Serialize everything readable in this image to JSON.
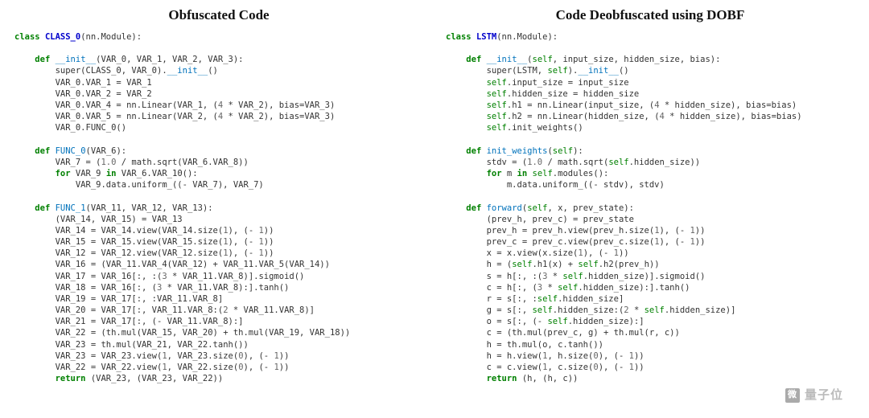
{
  "left": {
    "title": "Obfuscated Code",
    "code": [
      {
        "t": "line",
        "spans": [
          {
            "c": "kw",
            "s": "class "
          },
          {
            "c": "cls",
            "s": "CLASS_0"
          },
          {
            "c": "",
            "s": "(nn.Module):"
          }
        ]
      },
      {
        "t": "blank"
      },
      {
        "t": "line",
        "indent": 1,
        "spans": [
          {
            "c": "kw",
            "s": "def "
          },
          {
            "c": "fn",
            "s": "__init__"
          },
          {
            "c": "",
            "s": "(VAR_0, VAR_1, VAR_2, VAR_3):"
          }
        ]
      },
      {
        "t": "line",
        "indent": 2,
        "spans": [
          {
            "c": "",
            "s": "super(CLASS_0, VAR_0)."
          },
          {
            "c": "fn",
            "s": "__init__"
          },
          {
            "c": "",
            "s": "()"
          }
        ]
      },
      {
        "t": "line",
        "indent": 2,
        "spans": [
          {
            "c": "",
            "s": "VAR_0.VAR_1 = VAR_1"
          }
        ]
      },
      {
        "t": "line",
        "indent": 2,
        "spans": [
          {
            "c": "",
            "s": "VAR_0.VAR_2 = VAR_2"
          }
        ]
      },
      {
        "t": "line",
        "indent": 2,
        "spans": [
          {
            "c": "",
            "s": "VAR_0.VAR_4 = nn.Linear(VAR_1, ("
          },
          {
            "c": "num",
            "s": "4"
          },
          {
            "c": "",
            "s": " * VAR_2), bias=VAR_3)"
          }
        ]
      },
      {
        "t": "line",
        "indent": 2,
        "spans": [
          {
            "c": "",
            "s": "VAR_0.VAR_5 = nn.Linear(VAR_2, ("
          },
          {
            "c": "num",
            "s": "4"
          },
          {
            "c": "",
            "s": " * VAR_2), bias=VAR_3)"
          }
        ]
      },
      {
        "t": "line",
        "indent": 2,
        "spans": [
          {
            "c": "",
            "s": "VAR_0.FUNC_0()"
          }
        ]
      },
      {
        "t": "blank"
      },
      {
        "t": "line",
        "indent": 1,
        "spans": [
          {
            "c": "kw",
            "s": "def "
          },
          {
            "c": "fn",
            "s": "FUNC_0"
          },
          {
            "c": "",
            "s": "(VAR_6):"
          }
        ]
      },
      {
        "t": "line",
        "indent": 2,
        "spans": [
          {
            "c": "",
            "s": "VAR_7 = ("
          },
          {
            "c": "num",
            "s": "1.0"
          },
          {
            "c": "",
            "s": " / math.sqrt(VAR_6.VAR_8))"
          }
        ]
      },
      {
        "t": "line",
        "indent": 2,
        "spans": [
          {
            "c": "kw",
            "s": "for"
          },
          {
            "c": "",
            "s": " VAR_9 "
          },
          {
            "c": "kw",
            "s": "in"
          },
          {
            "c": "",
            "s": " VAR_6.VAR_10():"
          }
        ]
      },
      {
        "t": "line",
        "indent": 3,
        "spans": [
          {
            "c": "",
            "s": "VAR_9.data.uniform_((- VAR_7), VAR_7)"
          }
        ]
      },
      {
        "t": "blank"
      },
      {
        "t": "line",
        "indent": 1,
        "spans": [
          {
            "c": "kw",
            "s": "def "
          },
          {
            "c": "fn",
            "s": "FUNC_1"
          },
          {
            "c": "",
            "s": "(VAR_11, VAR_12, VAR_13):"
          }
        ]
      },
      {
        "t": "line",
        "indent": 2,
        "spans": [
          {
            "c": "",
            "s": "(VAR_14, VAR_15) = VAR_13"
          }
        ]
      },
      {
        "t": "line",
        "indent": 2,
        "spans": [
          {
            "c": "",
            "s": "VAR_14 = VAR_14.view(VAR_14.size("
          },
          {
            "c": "num",
            "s": "1"
          },
          {
            "c": "",
            "s": "), (- "
          },
          {
            "c": "num",
            "s": "1"
          },
          {
            "c": "",
            "s": "))"
          }
        ]
      },
      {
        "t": "line",
        "indent": 2,
        "spans": [
          {
            "c": "",
            "s": "VAR_15 = VAR_15.view(VAR_15.size("
          },
          {
            "c": "num",
            "s": "1"
          },
          {
            "c": "",
            "s": "), (- "
          },
          {
            "c": "num",
            "s": "1"
          },
          {
            "c": "",
            "s": "))"
          }
        ]
      },
      {
        "t": "line",
        "indent": 2,
        "spans": [
          {
            "c": "",
            "s": "VAR_12 = VAR_12.view(VAR_12.size("
          },
          {
            "c": "num",
            "s": "1"
          },
          {
            "c": "",
            "s": "), (- "
          },
          {
            "c": "num",
            "s": "1"
          },
          {
            "c": "",
            "s": "))"
          }
        ]
      },
      {
        "t": "line",
        "indent": 2,
        "spans": [
          {
            "c": "",
            "s": "VAR_16 = (VAR_11.VAR_4(VAR_12) + VAR_11.VAR_5(VAR_14))"
          }
        ]
      },
      {
        "t": "line",
        "indent": 2,
        "spans": [
          {
            "c": "",
            "s": "VAR_17 = VAR_16[:, :("
          },
          {
            "c": "num",
            "s": "3"
          },
          {
            "c": "",
            "s": " * VAR_11.VAR_8)].sigmoid()"
          }
        ]
      },
      {
        "t": "line",
        "indent": 2,
        "spans": [
          {
            "c": "",
            "s": "VAR_18 = VAR_16[:, ("
          },
          {
            "c": "num",
            "s": "3"
          },
          {
            "c": "",
            "s": " * VAR_11.VAR_8):].tanh()"
          }
        ]
      },
      {
        "t": "line",
        "indent": 2,
        "spans": [
          {
            "c": "",
            "s": "VAR_19 = VAR_17[:, :VAR_11.VAR_8]"
          }
        ]
      },
      {
        "t": "line",
        "indent": 2,
        "spans": [
          {
            "c": "",
            "s": "VAR_20 = VAR_17[:, VAR_11.VAR_8:("
          },
          {
            "c": "num",
            "s": "2"
          },
          {
            "c": "",
            "s": " * VAR_11.VAR_8)]"
          }
        ]
      },
      {
        "t": "line",
        "indent": 2,
        "spans": [
          {
            "c": "",
            "s": "VAR_21 = VAR_17[:, (- VAR_11.VAR_8):]"
          }
        ]
      },
      {
        "t": "line",
        "indent": 2,
        "spans": [
          {
            "c": "",
            "s": "VAR_22 = (th.mul(VAR_15, VAR_20) + th.mul(VAR_19, VAR_18))"
          }
        ]
      },
      {
        "t": "line",
        "indent": 2,
        "spans": [
          {
            "c": "",
            "s": "VAR_23 = th.mul(VAR_21, VAR_22.tanh())"
          }
        ]
      },
      {
        "t": "line",
        "indent": 2,
        "spans": [
          {
            "c": "",
            "s": "VAR_23 = VAR_23.view("
          },
          {
            "c": "num",
            "s": "1"
          },
          {
            "c": "",
            "s": ", VAR_23.size("
          },
          {
            "c": "num",
            "s": "0"
          },
          {
            "c": "",
            "s": "), (- "
          },
          {
            "c": "num",
            "s": "1"
          },
          {
            "c": "",
            "s": "))"
          }
        ]
      },
      {
        "t": "line",
        "indent": 2,
        "spans": [
          {
            "c": "",
            "s": "VAR_22 = VAR_22.view("
          },
          {
            "c": "num",
            "s": "1"
          },
          {
            "c": "",
            "s": ", VAR_22.size("
          },
          {
            "c": "num",
            "s": "0"
          },
          {
            "c": "",
            "s": "), (- "
          },
          {
            "c": "num",
            "s": "1"
          },
          {
            "c": "",
            "s": "))"
          }
        ]
      },
      {
        "t": "line",
        "indent": 2,
        "spans": [
          {
            "c": "kw",
            "s": "return"
          },
          {
            "c": "",
            "s": " (VAR_23, (VAR_23, VAR_22))"
          }
        ]
      }
    ]
  },
  "right": {
    "title": "Code Deobfuscated using DOBF",
    "code": [
      {
        "t": "line",
        "spans": [
          {
            "c": "kw",
            "s": "class "
          },
          {
            "c": "cls",
            "s": "LSTM"
          },
          {
            "c": "",
            "s": "(nn.Module):"
          }
        ]
      },
      {
        "t": "blank"
      },
      {
        "t": "line",
        "indent": 1,
        "spans": [
          {
            "c": "kw",
            "s": "def "
          },
          {
            "c": "fn",
            "s": "__init__"
          },
          {
            "c": "",
            "s": "("
          },
          {
            "c": "sf",
            "s": "self"
          },
          {
            "c": "",
            "s": ", input_size, hidden_size, bias):"
          }
        ]
      },
      {
        "t": "line",
        "indent": 2,
        "spans": [
          {
            "c": "",
            "s": "super(LSTM, "
          },
          {
            "c": "sf",
            "s": "self"
          },
          {
            "c": "",
            "s": ")."
          },
          {
            "c": "fn",
            "s": "__init__"
          },
          {
            "c": "",
            "s": "()"
          }
        ]
      },
      {
        "t": "line",
        "indent": 2,
        "spans": [
          {
            "c": "sf",
            "s": "self"
          },
          {
            "c": "",
            "s": ".input_size = input_size"
          }
        ]
      },
      {
        "t": "line",
        "indent": 2,
        "spans": [
          {
            "c": "sf",
            "s": "self"
          },
          {
            "c": "",
            "s": ".hidden_size = hidden_size"
          }
        ]
      },
      {
        "t": "line",
        "indent": 2,
        "spans": [
          {
            "c": "sf",
            "s": "self"
          },
          {
            "c": "",
            "s": ".h1 = nn.Linear(input_size, ("
          },
          {
            "c": "num",
            "s": "4"
          },
          {
            "c": "",
            "s": " * hidden_size), bias=bias)"
          }
        ]
      },
      {
        "t": "line",
        "indent": 2,
        "spans": [
          {
            "c": "sf",
            "s": "self"
          },
          {
            "c": "",
            "s": ".h2 = nn.Linear(hidden_size, ("
          },
          {
            "c": "num",
            "s": "4"
          },
          {
            "c": "",
            "s": " * hidden_size), bias=bias)"
          }
        ]
      },
      {
        "t": "line",
        "indent": 2,
        "spans": [
          {
            "c": "sf",
            "s": "self"
          },
          {
            "c": "",
            "s": ".init_weights()"
          }
        ]
      },
      {
        "t": "blank"
      },
      {
        "t": "line",
        "indent": 1,
        "spans": [
          {
            "c": "kw",
            "s": "def "
          },
          {
            "c": "fn",
            "s": "init_weights"
          },
          {
            "c": "",
            "s": "("
          },
          {
            "c": "sf",
            "s": "self"
          },
          {
            "c": "",
            "s": "):"
          }
        ]
      },
      {
        "t": "line",
        "indent": 2,
        "spans": [
          {
            "c": "",
            "s": "stdv = ("
          },
          {
            "c": "num",
            "s": "1.0"
          },
          {
            "c": "",
            "s": " / math.sqrt("
          },
          {
            "c": "sf",
            "s": "self"
          },
          {
            "c": "",
            "s": ".hidden_size))"
          }
        ]
      },
      {
        "t": "line",
        "indent": 2,
        "spans": [
          {
            "c": "kw",
            "s": "for"
          },
          {
            "c": "",
            "s": " m "
          },
          {
            "c": "kw",
            "s": "in"
          },
          {
            "c": "",
            "s": " "
          },
          {
            "c": "sf",
            "s": "self"
          },
          {
            "c": "",
            "s": ".modules():"
          }
        ]
      },
      {
        "t": "line",
        "indent": 3,
        "spans": [
          {
            "c": "",
            "s": "m.data.uniform_((- stdv), stdv)"
          }
        ]
      },
      {
        "t": "blank"
      },
      {
        "t": "line",
        "indent": 1,
        "spans": [
          {
            "c": "kw",
            "s": "def "
          },
          {
            "c": "fn",
            "s": "forward"
          },
          {
            "c": "",
            "s": "("
          },
          {
            "c": "sf",
            "s": "self"
          },
          {
            "c": "",
            "s": ", x, prev_state):"
          }
        ]
      },
      {
        "t": "line",
        "indent": 2,
        "spans": [
          {
            "c": "",
            "s": "(prev_h, prev_c) = prev_state"
          }
        ]
      },
      {
        "t": "line",
        "indent": 2,
        "spans": [
          {
            "c": "",
            "s": "prev_h = prev_h.view(prev_h.size("
          },
          {
            "c": "num",
            "s": "1"
          },
          {
            "c": "",
            "s": "), (- "
          },
          {
            "c": "num",
            "s": "1"
          },
          {
            "c": "",
            "s": "))"
          }
        ]
      },
      {
        "t": "line",
        "indent": 2,
        "spans": [
          {
            "c": "",
            "s": "prev_c = prev_c.view(prev_c.size("
          },
          {
            "c": "num",
            "s": "1"
          },
          {
            "c": "",
            "s": "), (- "
          },
          {
            "c": "num",
            "s": "1"
          },
          {
            "c": "",
            "s": "))"
          }
        ]
      },
      {
        "t": "line",
        "indent": 2,
        "spans": [
          {
            "c": "",
            "s": "x = x.view(x.size("
          },
          {
            "c": "num",
            "s": "1"
          },
          {
            "c": "",
            "s": "), (- "
          },
          {
            "c": "num",
            "s": "1"
          },
          {
            "c": "",
            "s": "))"
          }
        ]
      },
      {
        "t": "line",
        "indent": 2,
        "spans": [
          {
            "c": "",
            "s": "h = ("
          },
          {
            "c": "sf",
            "s": "self"
          },
          {
            "c": "",
            "s": ".h1(x) + "
          },
          {
            "c": "sf",
            "s": "self"
          },
          {
            "c": "",
            "s": ".h2(prev_h))"
          }
        ]
      },
      {
        "t": "line",
        "indent": 2,
        "spans": [
          {
            "c": "",
            "s": "s = h[:, :("
          },
          {
            "c": "num",
            "s": "3"
          },
          {
            "c": "",
            "s": " * "
          },
          {
            "c": "sf",
            "s": "self"
          },
          {
            "c": "",
            "s": ".hidden_size)].sigmoid()"
          }
        ]
      },
      {
        "t": "line",
        "indent": 2,
        "spans": [
          {
            "c": "",
            "s": "c = h[:, ("
          },
          {
            "c": "num",
            "s": "3"
          },
          {
            "c": "",
            "s": " * "
          },
          {
            "c": "sf",
            "s": "self"
          },
          {
            "c": "",
            "s": ".hidden_size):].tanh()"
          }
        ]
      },
      {
        "t": "line",
        "indent": 2,
        "spans": [
          {
            "c": "",
            "s": "r = s[:, :"
          },
          {
            "c": "sf",
            "s": "self"
          },
          {
            "c": "",
            "s": ".hidden_size]"
          }
        ]
      },
      {
        "t": "line",
        "indent": 2,
        "spans": [
          {
            "c": "",
            "s": "g = s[:, "
          },
          {
            "c": "sf",
            "s": "self"
          },
          {
            "c": "",
            "s": ".hidden_size:("
          },
          {
            "c": "num",
            "s": "2"
          },
          {
            "c": "",
            "s": " * "
          },
          {
            "c": "sf",
            "s": "self"
          },
          {
            "c": "",
            "s": ".hidden_size)]"
          }
        ]
      },
      {
        "t": "line",
        "indent": 2,
        "spans": [
          {
            "c": "",
            "s": "o = s[:, (- "
          },
          {
            "c": "sf",
            "s": "self"
          },
          {
            "c": "",
            "s": ".hidden_size):]"
          }
        ]
      },
      {
        "t": "line",
        "indent": 2,
        "spans": [
          {
            "c": "",
            "s": "c = (th.mul(prev_c, g) + th.mul(r, c))"
          }
        ]
      },
      {
        "t": "line",
        "indent": 2,
        "spans": [
          {
            "c": "",
            "s": "h = th.mul(o, c.tanh())"
          }
        ]
      },
      {
        "t": "line",
        "indent": 2,
        "spans": [
          {
            "c": "",
            "s": "h = h.view("
          },
          {
            "c": "num",
            "s": "1"
          },
          {
            "c": "",
            "s": ", h.size("
          },
          {
            "c": "num",
            "s": "0"
          },
          {
            "c": "",
            "s": "), (- "
          },
          {
            "c": "num",
            "s": "1"
          },
          {
            "c": "",
            "s": "))"
          }
        ]
      },
      {
        "t": "line",
        "indent": 2,
        "spans": [
          {
            "c": "",
            "s": "c = c.view("
          },
          {
            "c": "num",
            "s": "1"
          },
          {
            "c": "",
            "s": ", c.size("
          },
          {
            "c": "num",
            "s": "0"
          },
          {
            "c": "",
            "s": "), (- "
          },
          {
            "c": "num",
            "s": "1"
          },
          {
            "c": "",
            "s": "))"
          }
        ]
      },
      {
        "t": "line",
        "indent": 2,
        "spans": [
          {
            "c": "kw",
            "s": "return"
          },
          {
            "c": "",
            "s": " (h, (h, c))"
          }
        ]
      }
    ]
  },
  "watermark": {
    "icon": "微",
    "text": "量子位"
  },
  "indent_unit": "    "
}
